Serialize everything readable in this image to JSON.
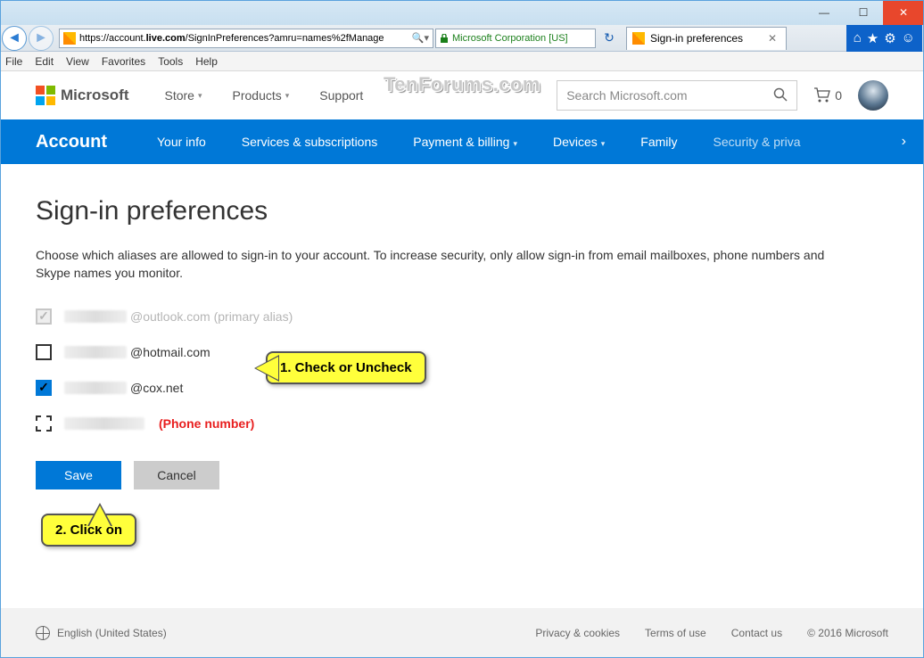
{
  "window": {
    "min": "—",
    "max": "☐",
    "close": "✕"
  },
  "browser": {
    "url_prefix": "https://",
    "url_host": "account.",
    "url_domain": "live.com",
    "url_path": "/SignInPreferences?amru=names%2fManage",
    "secure_label": "Microsoft Corporation [US]",
    "tab_title": "Sign-in preferences",
    "menus": [
      "File",
      "Edit",
      "View",
      "Favorites",
      "Tools",
      "Help"
    ],
    "nav_icons": [
      "⌂",
      "★",
      "⚙",
      "☺"
    ]
  },
  "header": {
    "logo_text": "Microsoft",
    "nav": [
      "Store",
      "Products",
      "Support"
    ],
    "search_placeholder": "Search Microsoft.com",
    "cart_count": "0"
  },
  "account_nav": {
    "title": "Account",
    "items": [
      {
        "label": "Your info",
        "caret": false
      },
      {
        "label": "Services & subscriptions",
        "caret": false
      },
      {
        "label": "Payment & billing",
        "caret": true
      },
      {
        "label": "Devices",
        "caret": true
      },
      {
        "label": "Family",
        "caret": false
      },
      {
        "label": "Security & priva",
        "caret": false,
        "dim": true
      }
    ]
  },
  "page": {
    "title": "Sign-in preferences",
    "desc": "Choose which aliases are allowed to sign-in to your account. To increase security, only allow sign-in from email mailboxes, phone numbers and Skype names you monitor.",
    "aliases": [
      {
        "suffix": "@outlook.com (primary alias)",
        "state": "disabled"
      },
      {
        "suffix": "@hotmail.com",
        "state": "unchecked"
      },
      {
        "suffix": "@cox.net",
        "state": "checked"
      },
      {
        "suffix": "",
        "state": "dotted",
        "extra": "(Phone number)"
      }
    ],
    "save": "Save",
    "cancel": "Cancel"
  },
  "callouts": {
    "c1": "1. Check or Uncheck",
    "c2": "2. Click on"
  },
  "footer": {
    "lang": "English (United States)",
    "links": [
      "Privacy & cookies",
      "Terms of use",
      "Contact us"
    ],
    "copyright": "© 2016 Microsoft"
  },
  "watermark": "TenForums.com"
}
